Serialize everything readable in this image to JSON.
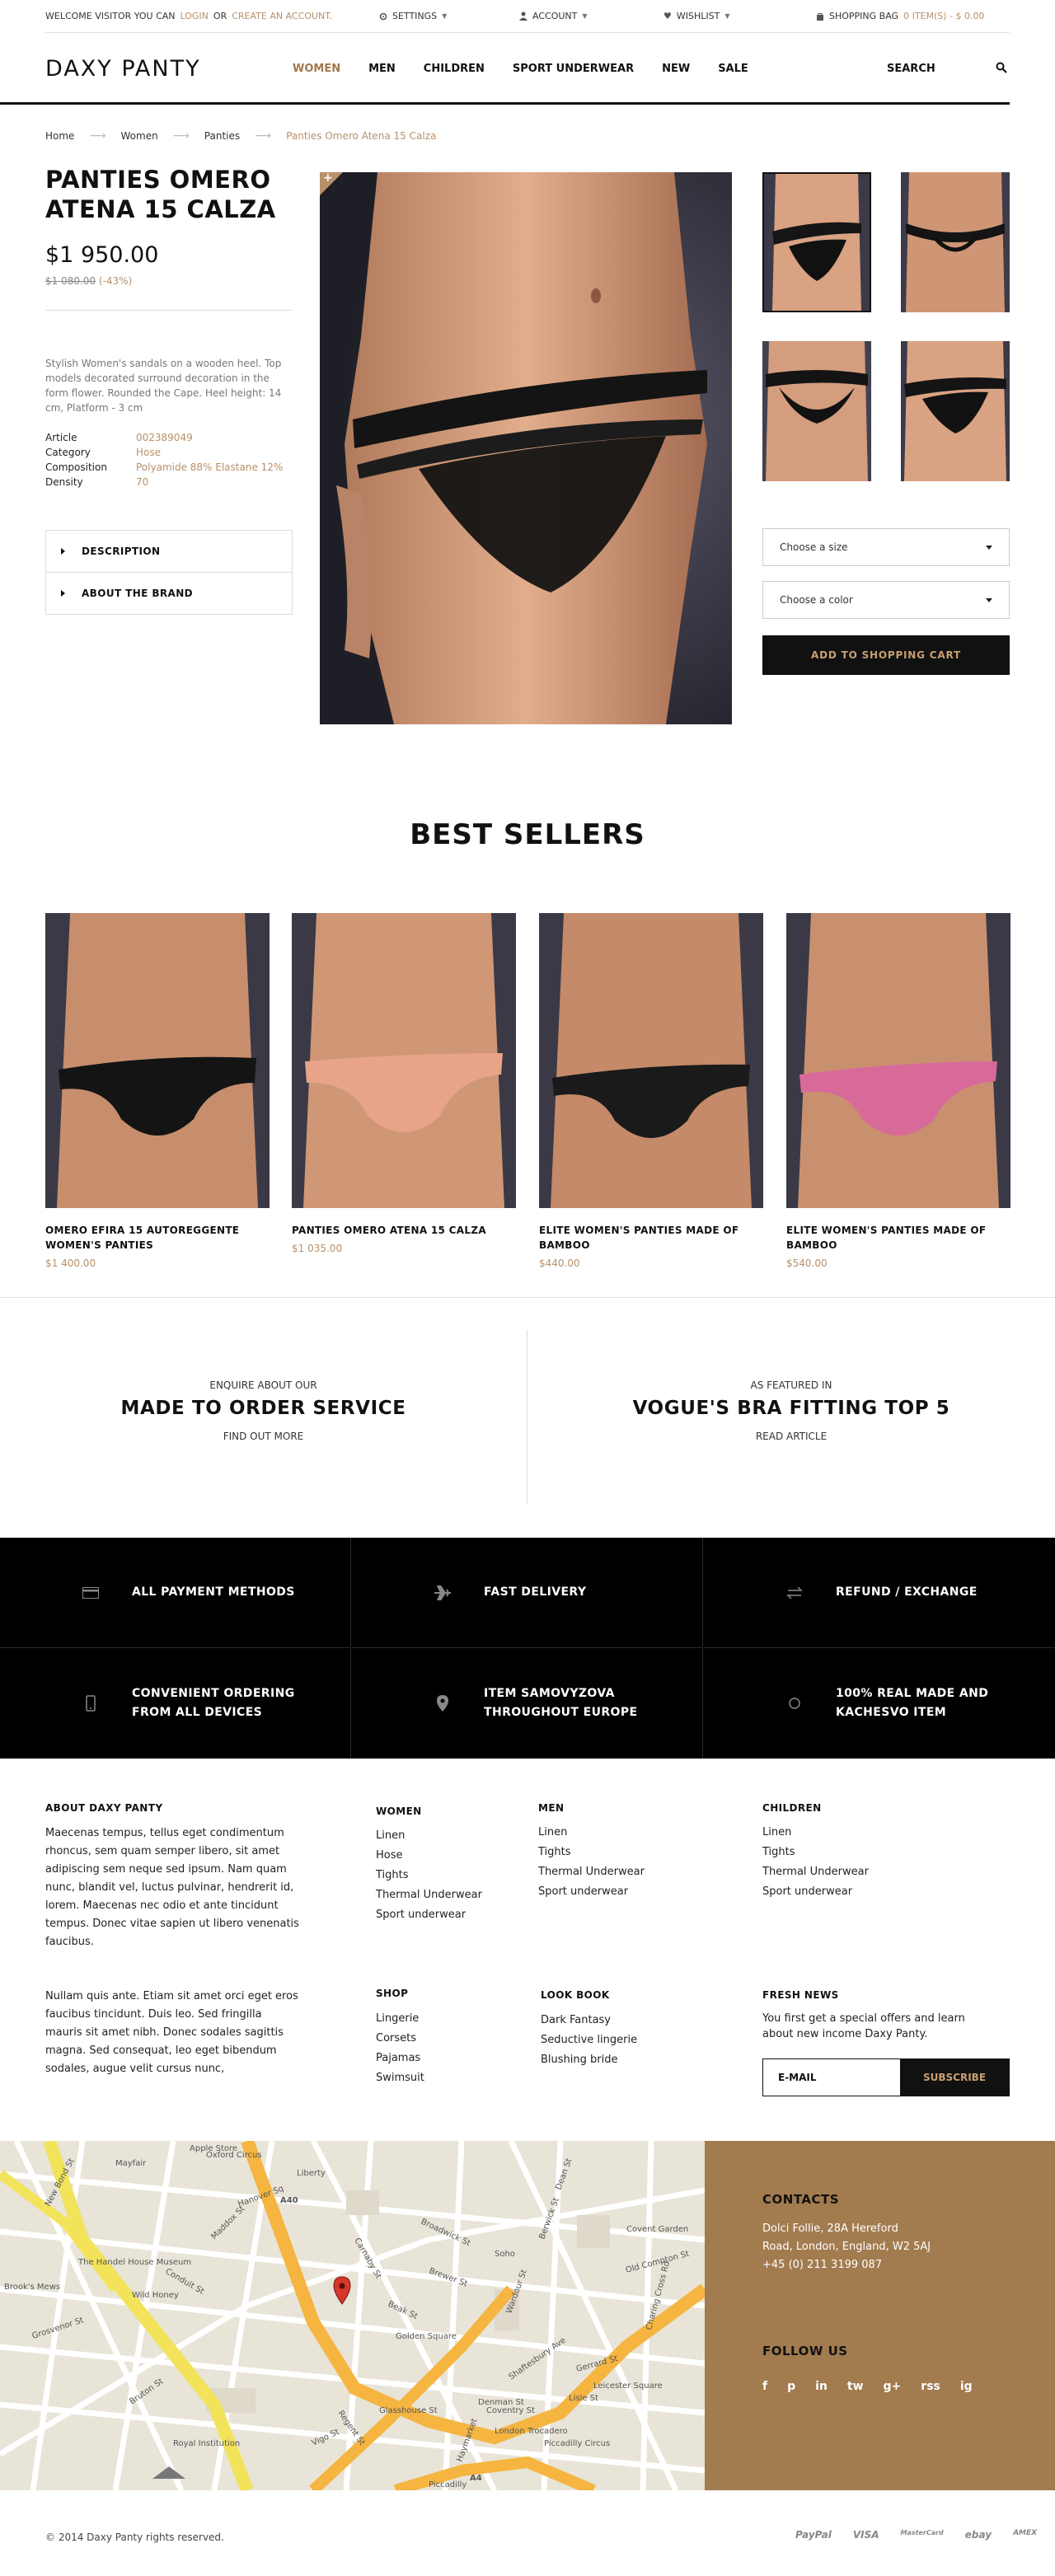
{
  "topbar": {
    "welcome_prefix": "WELCOME VISITOR YOU CAN",
    "login": "LOGIN",
    "or": "OR",
    "create_account": "CREATE AN ACCOUNT.",
    "settings": "SETTINGS",
    "account": "ACCOUNT",
    "wishlist": "WISHLIST",
    "bag_label": "SHOPPING BAG",
    "bag_count": "0 ITEM(S) - $ 0.00"
  },
  "header": {
    "logo": "DAXY PANTY",
    "nav": [
      "WOMEN",
      "MEN",
      "CHILDREN",
      "SPORT UNDERWEAR",
      "NEW",
      "SALE"
    ],
    "search_label": "SEARCH"
  },
  "breadcrumb": [
    "Home",
    "Women",
    "Panties",
    "Panties Omero Atena 15 Calza"
  ],
  "product": {
    "title": "PANTIES OMERO ATENA 15 CALZA",
    "price": "$1 950.00",
    "old_price": "$1 080.00",
    "discount": "(-43%)",
    "description": "Stylish Women's sandals on a wooden heel. Top models decorated surround decoration in the form flower. Rounded the Cape. Heel height: 14 cm, Platform - 3 cm",
    "specs": [
      {
        "label": "Article",
        "value": "002389049"
      },
      {
        "label": "Category",
        "value": "Hose"
      },
      {
        "label": "Composition",
        "value": "Polyamide 88% Elastane 12%"
      },
      {
        "label": "Density",
        "value": "70"
      }
    ],
    "accordion": [
      "DESCRIPTION",
      "ABOUT THE BRAND"
    ],
    "size_placeholder": "Choose a size",
    "color_placeholder": "Choose a color",
    "add_to_cart": "ADD TO SHOPPING CART"
  },
  "best_sellers": {
    "title": "BEST SELLERS",
    "items": [
      {
        "name": "OMERO EFIRA 15 AUTOREGGENTE WOMEN'S PANTIES",
        "price": "$1 400.00",
        "color": "#141414"
      },
      {
        "name": "PANTIES OMERO ATENA 15 CALZA",
        "price": "$1 035.00",
        "color": "#e8a488"
      },
      {
        "name": "ELITE WOMEN'S PANTIES MADE OF BAMBOO",
        "price": "$440.00",
        "color": "#1a1a1a"
      },
      {
        "name": "ELITE WOMEN'S PANTIES MADE OF BAMBOO",
        "price": "$540.00",
        "color": "#d86a9a"
      }
    ]
  },
  "promos": [
    {
      "kicker": "ENQUIRE ABOUT OUR",
      "title": "MADE TO ORDER SERVICE",
      "link": "FIND OUT MORE"
    },
    {
      "kicker": "AS FEATURED IN",
      "title": "VOGUE'S BRA FITTING TOP 5",
      "link": "READ ARTICLE"
    }
  ],
  "features": [
    {
      "label": "ALL PAYMENT METHODS",
      "icon": "credit-card-icon"
    },
    {
      "label": "FAST DELIVERY",
      "icon": "airplane-icon"
    },
    {
      "label": "REFUND / EXCHANGE",
      "icon": "exchange-icon"
    },
    {
      "label": "CONVENIENT ORDERING FROM ALL DEVICES",
      "icon": "mobile-icon"
    },
    {
      "label": "ITEM SAMOVYZOVA THROUGHOUT EUROPE",
      "icon": "map-pin-icon"
    },
    {
      "label": "100% REAL MADE AND KACHESVO ITEM",
      "icon": "circle-icon"
    }
  ],
  "footer": {
    "about_title": "ABOUT DAXY PANTY",
    "about_p1": "Maecenas tempus, tellus eget condimentum rhoncus, sem quam semper libero, sit amet adipiscing sem neque sed ipsum. Nam quam nunc, blandit vel, luctus pulvinar, hendrerit id, lorem. Maecenas nec odio et ante tincidunt tempus. Donec vitae sapien ut libero venenatis faucibus.",
    "about_p2": "Nullam quis ante. Etiam sit amet orci eget eros faucibus tincidunt. Duis leo. Sed fringilla mauris sit amet nibh. Donec sodales sagittis magna. Sed consequat, leo eget bibendum sodales, augue velit cursus nunc,",
    "women_title": "WOMEN",
    "women": [
      "Linen",
      "Hose",
      "Tights",
      "Thermal Underwear",
      "Sport underwear"
    ],
    "men_title": "MEN",
    "men": [
      "Linen",
      "Tights",
      "Thermal Underwear",
      "Sport underwear"
    ],
    "children_title": "CHILDREN",
    "children": [
      "Linen",
      "Tights",
      "Thermal Underwear",
      "Sport underwear"
    ],
    "shop_title": "SHOP",
    "shop": [
      "Lingerie",
      "Corsets",
      "Pajamas",
      "Swimsuit"
    ],
    "lookbook_title": "LOOK BOOK",
    "lookbook": [
      "Dark Fantasy",
      "Seductive lingerie",
      "Blushing bride"
    ],
    "news_title": "FRESH NEWS",
    "news_text": "You first get a special offers and learn about new income Daxy Panty.",
    "email_placeholder": "E-MAIL",
    "subscribe": "SUBSCRIBE"
  },
  "contacts": {
    "title": "CONTACTS",
    "address_line1": "Dolci Follie, 28A Hereford",
    "address_line2": "Road, London, England, W2 5AJ",
    "phone": "+45 (0) 211 3199 087",
    "follow_title": "FOLLOW US",
    "social": [
      "f",
      "p",
      "in",
      "tw",
      "g+",
      "rss",
      "ig"
    ]
  },
  "map_labels": [
    "New Bond St",
    "Regent St",
    "Mayfair",
    "Piccadilly Circus",
    "Soho",
    "Covent Garden",
    "Leicester Square",
    "Oxford Circus",
    "Golden Square",
    "Glasshouse St",
    "Denman St",
    "Brewer St",
    "Wardour St",
    "Dean St",
    "Old Compton St",
    "Berwick St",
    "Charing Cross Rd",
    "Shaftesbury Ave",
    "Broadwick St",
    "Beak St",
    "Conduit St",
    "Maddox St",
    "Vigo St",
    "Bruton St",
    "Grosvenor St",
    "Hanover Sq",
    "Carnaby St",
    "Piccadilly",
    "Haymarket",
    "Coventry St",
    "London Trocadero",
    "Gerrard St",
    "Lisle St",
    "Brook's Mews",
    "Wild Honey",
    "The Handel House Museum",
    "Apple Store",
    "Liberty",
    "Royal Institution",
    "A4",
    "A40"
  ],
  "copyright": "© 2014 Daxy Panty rights reserved.",
  "payments": [
    "PayPal",
    "VISA",
    "MasterCard",
    "ebay",
    "AMEX"
  ]
}
